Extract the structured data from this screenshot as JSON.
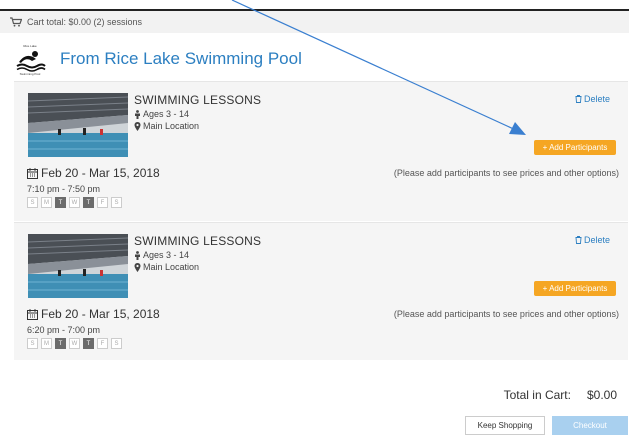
{
  "cart": {
    "summary": "Cart total: $0.00 (2) sessions"
  },
  "provider": {
    "name": "From Rice Lake Swimming Pool",
    "logo_text_top": "Rice Lake",
    "logo_text_bottom": "Swimming Pool"
  },
  "items": [
    {
      "title": "SWIMMING LESSONS",
      "ages": "Ages 3 - 14",
      "location": "Main Location",
      "delete_label": "Delete",
      "add_label": "+ Add Participants",
      "date_range": "Feb 20 - Mar 15, 2018",
      "time": "7:10 pm - 7:50 pm",
      "note": "(Please add participants to see prices and other options)",
      "days": [
        {
          "label": "S",
          "active": false
        },
        {
          "label": "M",
          "active": false
        },
        {
          "label": "T",
          "active": true
        },
        {
          "label": "W",
          "active": false
        },
        {
          "label": "T",
          "active": true
        },
        {
          "label": "F",
          "active": false
        },
        {
          "label": "S",
          "active": false
        }
      ]
    },
    {
      "title": "SWIMMING LESSONS",
      "ages": "Ages 3 - 14",
      "location": "Main Location",
      "delete_label": "Delete",
      "add_label": "+ Add Participants",
      "date_range": "Feb 20 - Mar 15, 2018",
      "time": "6:20 pm - 7:00 pm",
      "note": "(Please add participants to see prices and other options)",
      "days": [
        {
          "label": "S",
          "active": false
        },
        {
          "label": "M",
          "active": false
        },
        {
          "label": "T",
          "active": true
        },
        {
          "label": "W",
          "active": false
        },
        {
          "label": "T",
          "active": true
        },
        {
          "label": "F",
          "active": false
        },
        {
          "label": "S",
          "active": false
        }
      ]
    }
  ],
  "totals": {
    "label": "Total in Cart:",
    "amount": "$0.00"
  },
  "actions": {
    "keep_shopping": "Keep Shopping",
    "checkout": "Checkout"
  },
  "colors": {
    "link_blue": "#2c7fc1",
    "add_orange": "#f5a623",
    "checkout_disabled": "#a9d0ef"
  },
  "icons": [
    "cart-icon",
    "swimmer-logo-icon",
    "person-icon",
    "map-marker-icon",
    "trash-icon",
    "calendar-icon",
    "arrow-annotation-icon"
  ]
}
